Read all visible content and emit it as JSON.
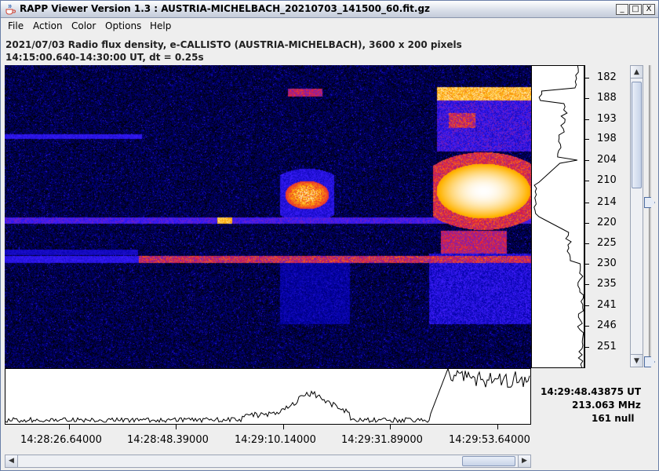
{
  "window": {
    "title": "RAPP Viewer Version 1.3 : AUSTRIA-MICHELBACH_20210703_141500_60.fit.gz",
    "buttons": {
      "minimize": "_",
      "maximize": "□",
      "close": "X"
    }
  },
  "menu": [
    "File",
    "Action",
    "Color",
    "Options",
    "Help"
  ],
  "info": {
    "line1": "2021/07/03  Radio flux density, e-CALLISTO (AUSTRIA-MICHELBACH),  3600 x 200 pixels",
    "line2": "14:15:00.640-14:30:00 UT,  dt = 0.25s"
  },
  "freq_axis": {
    "labels": [
      "182",
      "188",
      "193",
      "198",
      "204",
      "210",
      "214",
      "220",
      "225",
      "230",
      "235",
      "241",
      "246",
      "251"
    ]
  },
  "time_axis": {
    "labels": [
      "14:28:26.64000",
      "14:28:48.39000",
      "14:29:10.14000",
      "14:29:31.89000",
      "14:29:53.64000"
    ]
  },
  "readout": {
    "time": "14:29:48.43875 UT",
    "frequency": "213.063 MHz",
    "value": "161 null"
  },
  "icons": {
    "app": "java-cup-icon",
    "scroll_up": "arrow-up-icon",
    "scroll_down": "arrow-down-icon",
    "scroll_left": "arrow-left-icon",
    "scroll_right": "arrow-right-icon"
  }
}
